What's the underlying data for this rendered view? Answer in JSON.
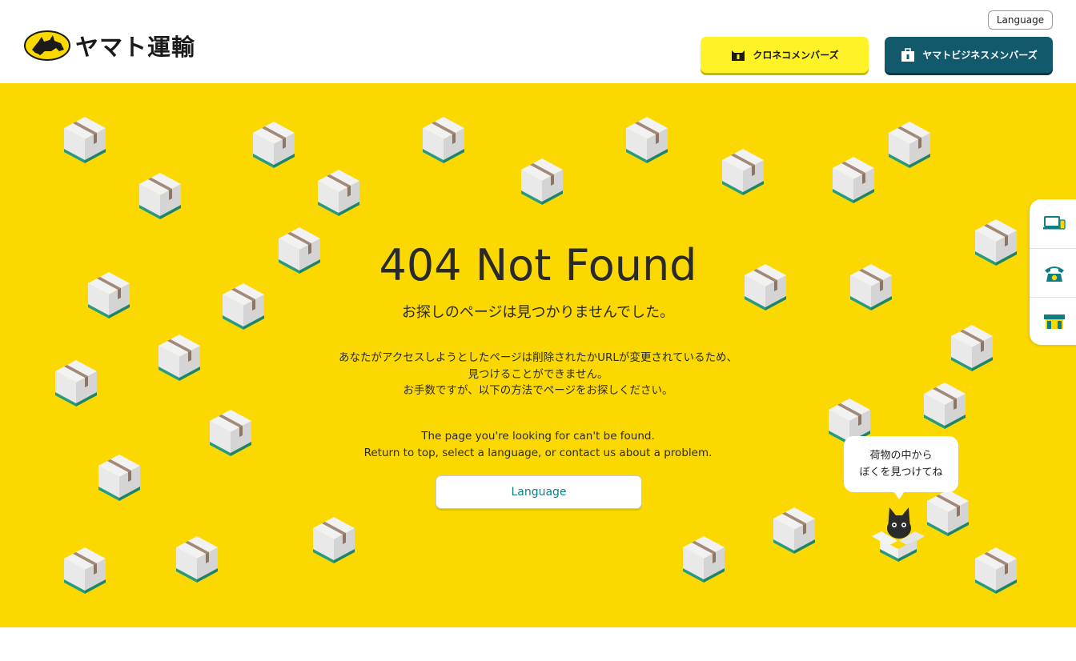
{
  "header": {
    "logo_text": "ヤマト運輸",
    "language_label": "Language",
    "kuroneko_label": "クロネコメンバーズ",
    "business_label": "ヤマトビジネスメンバーズ"
  },
  "main": {
    "title": "404 Not Found",
    "subtitle": "お探しのページは見つかりませんでした。",
    "ja_lines": [
      "あなたがアクセスしようとしたページは削除されたかURLが変更されているため、",
      "見つけることができません。",
      "お手数ですが、以下の方法でページをお探しください。"
    ],
    "en_lines": [
      "The page you're looking for can't be found.",
      "Return to top, select a language, or contact us about a problem."
    ],
    "language_button": "Language",
    "bubble_lines": [
      "荷物の中から",
      "ぼくを見つけてね"
    ]
  },
  "side_tabs": [
    {
      "icon": "pc-phone-icon"
    },
    {
      "icon": "telephone-icon"
    },
    {
      "icon": "store-icon"
    }
  ],
  "colors": {
    "brand_yellow": "#fbd900",
    "button_yellow": "#fff226",
    "business_teal": "#11596b",
    "link_teal": "#0f7d86",
    "box_green": "#2a9b7a"
  }
}
